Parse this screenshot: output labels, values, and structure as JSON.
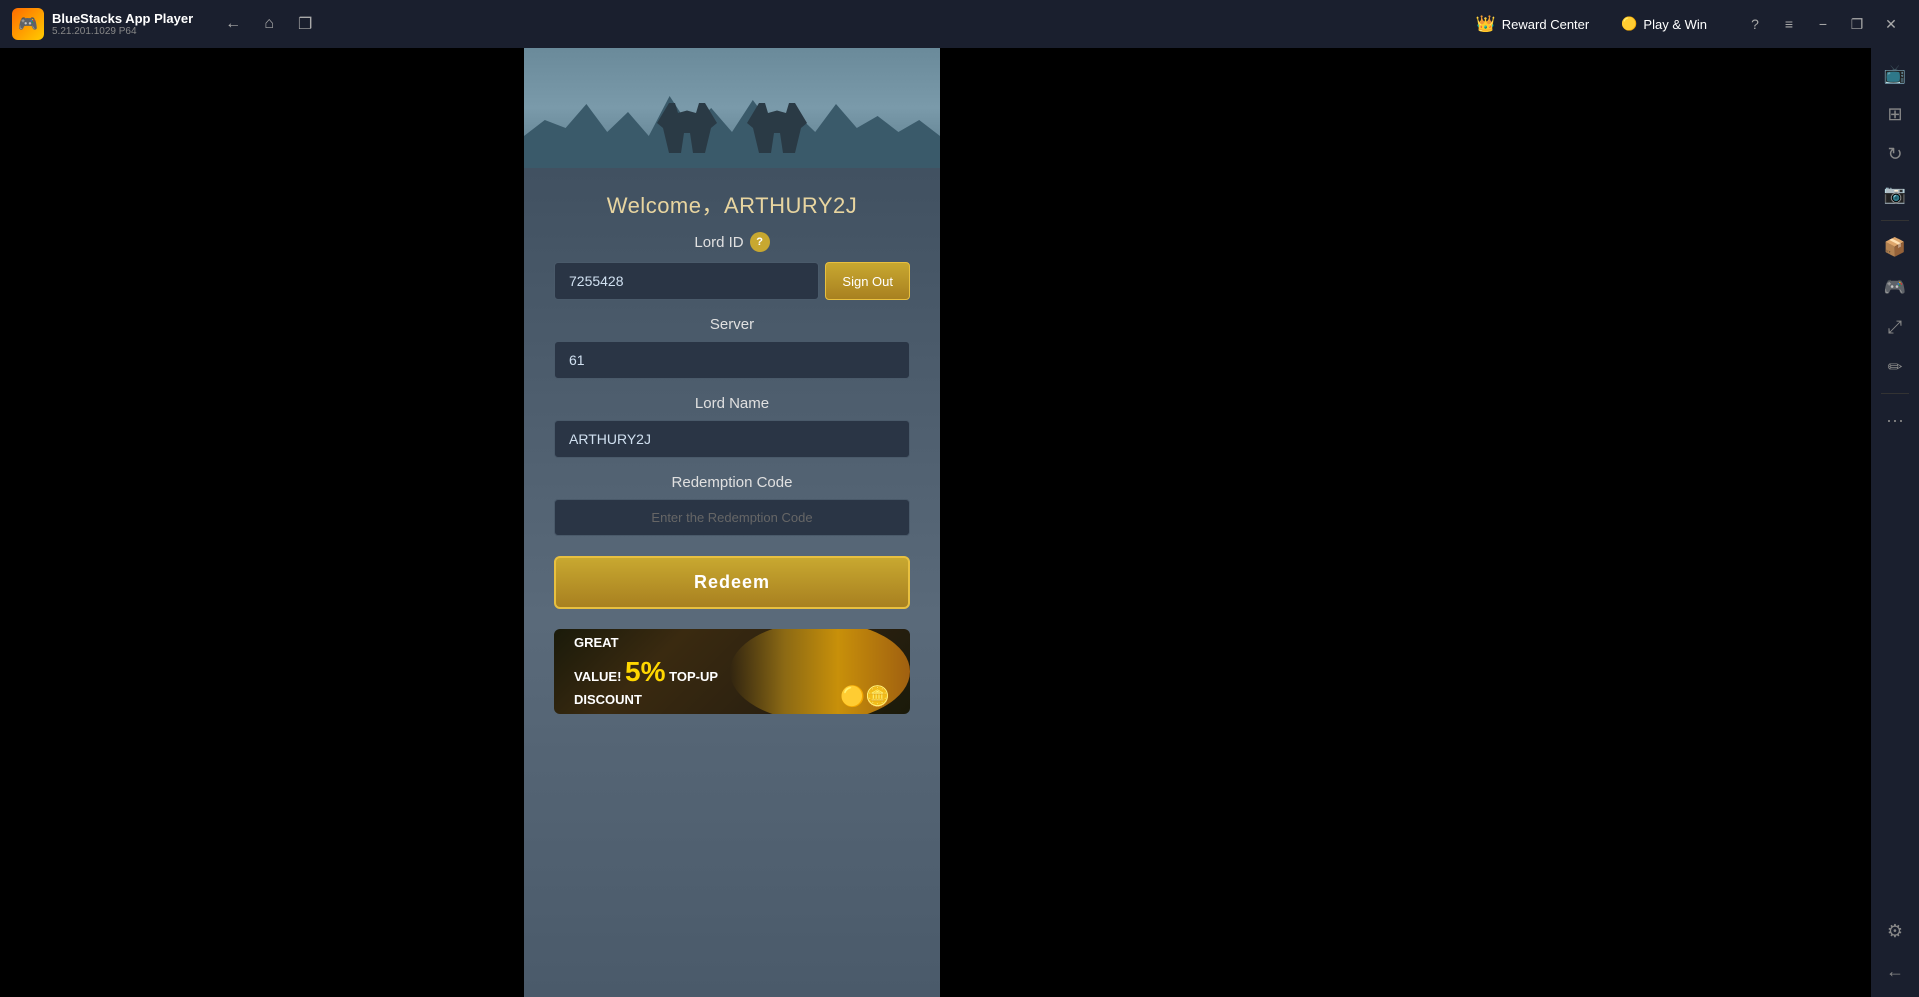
{
  "titlebar": {
    "app_name": "BlueStacks App Player",
    "app_version": "5.21.201.1029  P64",
    "logo_emoji": "🎮",
    "nav": {
      "back_label": "←",
      "home_label": "⌂",
      "multi_label": "❐"
    },
    "reward_center_label": "Reward Center",
    "reward_center_icon": "👑",
    "play_win_label": "Play & Win",
    "play_win_icon": "🟡",
    "help_icon": "?",
    "menu_icon": "≡",
    "minimize_icon": "−",
    "restore_icon": "❐",
    "close_icon": "✕"
  },
  "form": {
    "welcome_text": "Welcome，ARTHURY2J",
    "lord_id_label": "Lord ID",
    "lord_id_help": "?",
    "lord_id_value": "7255428",
    "sign_out_label": "Sign Out",
    "server_label": "Server",
    "server_value": "61",
    "lord_name_label": "Lord Name",
    "lord_name_value": "ARTHURY2J",
    "redemption_code_label": "Redemption Code",
    "redemption_code_placeholder": "Enter the Redemption Code",
    "redeem_button_label": "Redeem"
  },
  "banner": {
    "line1": "GREAT",
    "line2": "VALUE!",
    "percent": "5%",
    "line3": "TOP-UP",
    "line4": "DISCOUNT"
  },
  "sidebar": {
    "icons": [
      {
        "name": "tv-icon",
        "glyph": "📺"
      },
      {
        "name": "grid-icon",
        "glyph": "⊞"
      },
      {
        "name": "rotation-icon",
        "glyph": "↻"
      },
      {
        "name": "camera-icon",
        "glyph": "📷"
      },
      {
        "name": "apk-icon",
        "glyph": "📦"
      },
      {
        "name": "gamepad-icon",
        "glyph": "🎮"
      },
      {
        "name": "resize-icon",
        "glyph": "⤢"
      },
      {
        "name": "edit-icon",
        "glyph": "✏"
      },
      {
        "name": "more-icon",
        "glyph": "•••"
      },
      {
        "name": "settings-icon",
        "glyph": "⚙"
      },
      {
        "name": "back-icon",
        "glyph": "←"
      }
    ]
  }
}
